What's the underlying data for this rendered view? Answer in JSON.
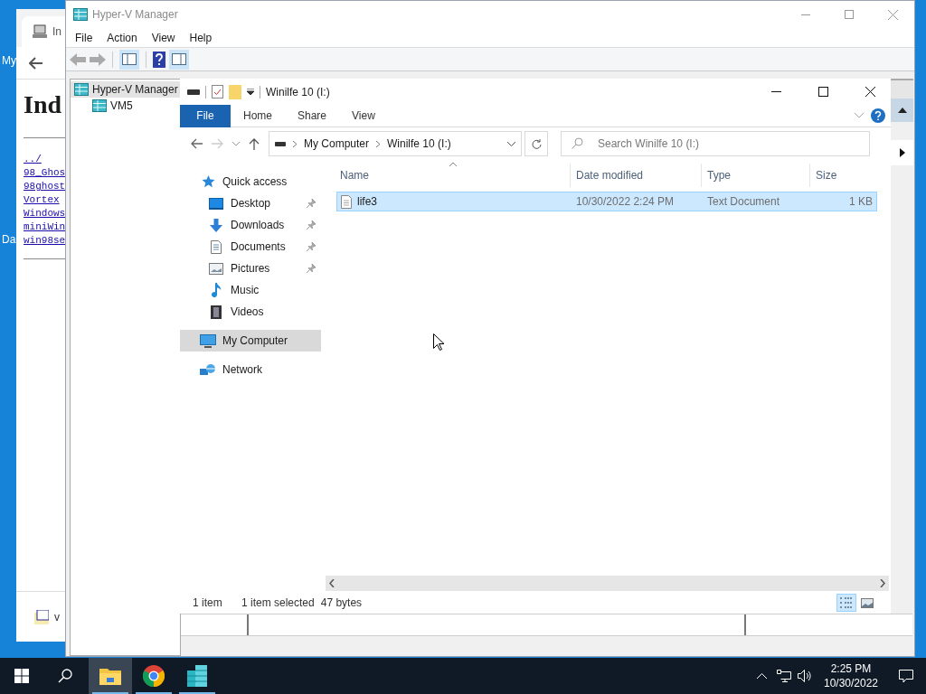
{
  "desktop": {
    "icon_labels": [
      "My",
      "Da"
    ]
  },
  "browser": {
    "tab_title": "In",
    "heading": "Ind",
    "links": [
      "../",
      "98_Ghos",
      "98ghost",
      "Vortex",
      "Windows",
      "miniWin",
      "win98se"
    ],
    "download_label": "v"
  },
  "hyperv": {
    "title": "Hyper-V Manager",
    "menu": [
      "File",
      "Action",
      "View",
      "Help"
    ],
    "tree": [
      {
        "label": "Hyper-V Manager",
        "selected": true,
        "children": [
          {
            "label": "VM5",
            "selected": false
          }
        ]
      }
    ]
  },
  "explorer": {
    "title": "Winilfe 10 (I:)",
    "ribbon_tabs": [
      {
        "label": "File",
        "selected": true
      },
      {
        "label": "Home",
        "selected": false
      },
      {
        "label": "Share",
        "selected": false
      },
      {
        "label": "View",
        "selected": false
      }
    ],
    "breadcrumb": [
      "My Computer",
      "Winilfe 10 (I:)"
    ],
    "search": {
      "placeholder": "Search Winilfe 10 (I:)"
    },
    "nav": [
      {
        "label": "Quick access",
        "kind": "star",
        "selected": false,
        "children": [
          {
            "label": "Desktop",
            "kind": "desktop",
            "selected": false,
            "pinned": true
          },
          {
            "label": "Downloads",
            "kind": "download",
            "selected": false,
            "pinned": true
          },
          {
            "label": "Documents",
            "kind": "document",
            "selected": false,
            "pinned": true
          },
          {
            "label": "Pictures",
            "kind": "picture",
            "selected": false,
            "pinned": true
          },
          {
            "label": "Music",
            "kind": "music",
            "selected": false,
            "pinned": false
          },
          {
            "label": "Videos",
            "kind": "video",
            "selected": false,
            "pinned": false
          }
        ]
      },
      {
        "label": "My Computer",
        "kind": "computer",
        "selected": true
      },
      {
        "label": "Network",
        "kind": "network",
        "selected": false
      }
    ],
    "columns": [
      "Name",
      "Date modified",
      "Type",
      "Size"
    ],
    "rows": [
      {
        "name": "life3",
        "date": "10/30/2022 2:24 PM",
        "type": "Text Document",
        "size": "1 KB",
        "selected": true
      }
    ],
    "status": {
      "count": "1 item",
      "selection": "1 item selected",
      "size": "47 bytes"
    }
  },
  "taskbar": {
    "apps": [
      {
        "kind": "explorer",
        "active": true
      },
      {
        "kind": "chrome",
        "active": false
      },
      {
        "kind": "hyperv",
        "active": false
      }
    ],
    "time": "2:25 PM",
    "date": "10/30/2022"
  }
}
